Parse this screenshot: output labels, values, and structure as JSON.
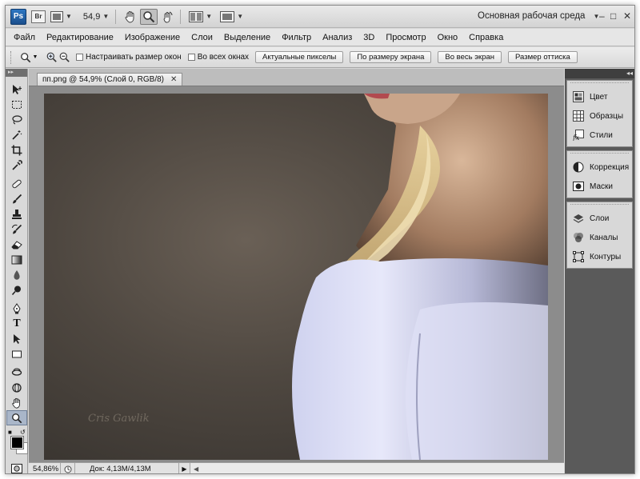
{
  "appbar": {
    "logo": "Ps",
    "bridge_label": "Br",
    "zoom_value": "54,9",
    "workspace_label": "Основная рабочая среда",
    "win_min": "–",
    "win_max": "□",
    "win_close": "✕"
  },
  "menu": [
    "Файл",
    "Редактирование",
    "Изображение",
    "Слои",
    "Выделение",
    "Фильтр",
    "Анализ",
    "3D",
    "Просмотр",
    "Окно",
    "Справка"
  ],
  "options": {
    "resize_windows_label": "Настраивать размер окон",
    "all_windows_label": "Во всех окнах",
    "btn_actual_pixels": "Актуальные пикселы",
    "btn_fit_screen": "По размеру экрана",
    "btn_fill_screen": "Во весь экран",
    "btn_print_size": "Размер оттиска"
  },
  "document": {
    "tab_title": "пп.png @ 54,9% (Слой 0, RGB/8)",
    "tab_close": "✕",
    "watermark": "Cris Gawlik"
  },
  "statusbar": {
    "zoom": "54,86%",
    "doc_info": "Док: 4,13M/4,13M",
    "arrow": "▶",
    "scroll_left": "◀"
  },
  "panels": {
    "collapse_label": "◂◂",
    "groups": [
      [
        {
          "label": "Цвет",
          "icon": "color-icon"
        },
        {
          "label": "Образцы",
          "icon": "swatches-icon"
        },
        {
          "label": "Стили",
          "icon": "styles-icon"
        }
      ],
      [
        {
          "label": "Коррекция",
          "icon": "adjustments-icon"
        },
        {
          "label": "Маски",
          "icon": "masks-icon"
        }
      ],
      [
        {
          "label": "Слои",
          "icon": "layers-icon"
        },
        {
          "label": "Каналы",
          "icon": "channels-icon"
        },
        {
          "label": "Контуры",
          "icon": "paths-icon"
        }
      ]
    ]
  },
  "toolbox": {
    "collapse_label": "▸▸",
    "tools": [
      "move-icon",
      "marquee-icon",
      "lasso-icon",
      "magic-wand-icon",
      "crop-icon",
      "eyedropper-icon",
      "healing-icon",
      "brush-icon",
      "clone-stamp-icon",
      "history-brush-icon",
      "eraser-icon",
      "gradient-icon",
      "blur-icon",
      "dodge-icon",
      "pen-icon",
      "type-icon",
      "path-select-icon",
      "shape-icon",
      "3d-rotate-icon",
      "3d-orbit-icon",
      "hand-icon",
      "zoom-icon"
    ],
    "active_tool": "zoom-icon",
    "type_glyph": "T"
  },
  "colors": {
    "foreground": "#000000",
    "background": "#ffffff"
  }
}
